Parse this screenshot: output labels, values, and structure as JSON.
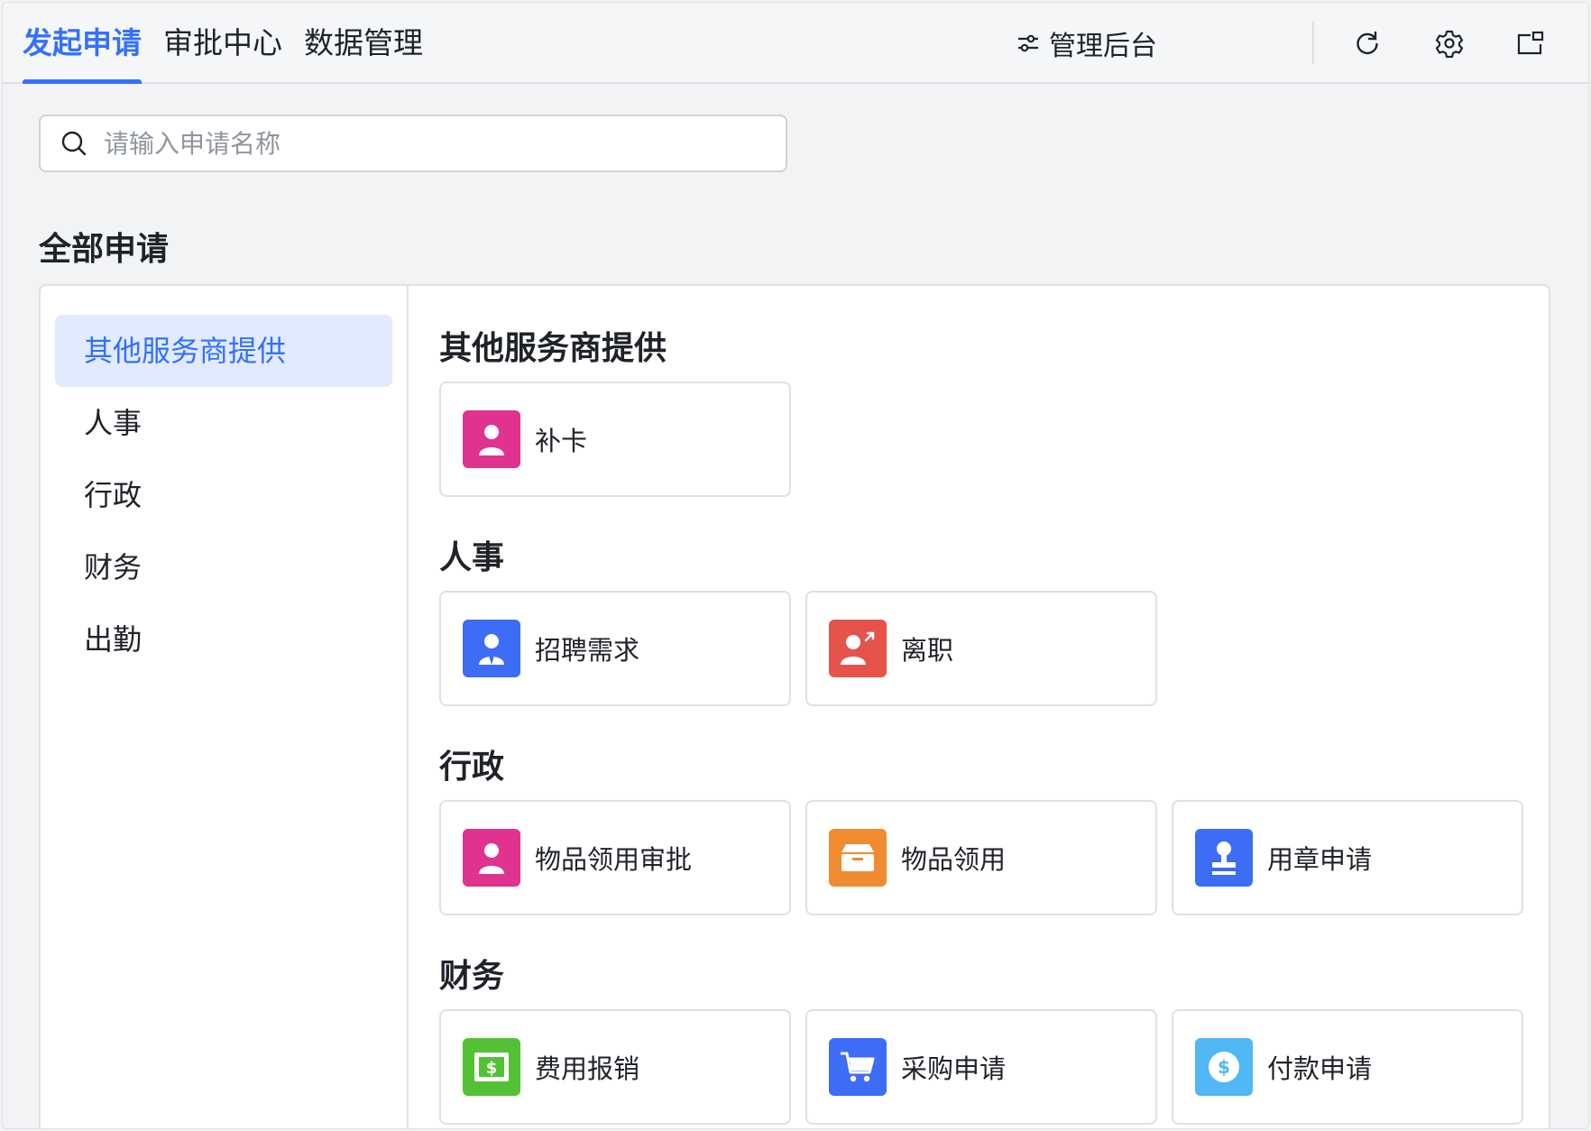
{
  "tabs": [
    {
      "label": "发起申请",
      "active": true
    },
    {
      "label": "审批中心",
      "active": false
    },
    {
      "label": "数据管理",
      "active": false
    }
  ],
  "toolbar": {
    "admin_label": "管理后台",
    "admin_icon": "sliders-icon",
    "refresh_icon": "refresh-icon",
    "settings_icon": "gear-icon",
    "window_icon": "external-window-icon"
  },
  "search": {
    "placeholder": "请输入申请名称",
    "value": ""
  },
  "page_title": "全部申请",
  "sidebar": {
    "items": [
      {
        "label": "其他服务商提供",
        "active": true
      },
      {
        "label": "人事",
        "active": false
      },
      {
        "label": "行政",
        "active": false
      },
      {
        "label": "财务",
        "active": false
      },
      {
        "label": "出勤",
        "active": false
      }
    ]
  },
  "sections": [
    {
      "title": "其他服务商提供",
      "cards": [
        {
          "name": "补卡",
          "icon": "person-icon",
          "color": "#e0338f"
        }
      ]
    },
    {
      "title": "人事",
      "cards": [
        {
          "name": "招聘需求",
          "icon": "person-tie-icon",
          "color": "#3d6cf5"
        },
        {
          "name": "离职",
          "icon": "person-leave-icon",
          "color": "#e5534b"
        }
      ]
    },
    {
      "title": "行政",
      "cards": [
        {
          "name": "物品领用审批",
          "icon": "person-icon",
          "color": "#e0338f"
        },
        {
          "name": "物品领用",
          "icon": "box-icon",
          "color": "#f08b2f"
        },
        {
          "name": "用章申请",
          "icon": "stamp-icon",
          "color": "#3d6cf5"
        }
      ]
    },
    {
      "title": "财务",
      "cards": [
        {
          "name": "费用报销",
          "icon": "cash-icon",
          "color": "#52c234"
        },
        {
          "name": "采购申请",
          "icon": "cart-icon",
          "color": "#3d6cf5"
        },
        {
          "name": "付款申请",
          "icon": "coin-icon",
          "color": "#4fb8f5"
        }
      ]
    }
  ],
  "colors": {
    "accent": "#3370ff",
    "active_bg": "#e1eaff",
    "border": "#dee0e3"
  }
}
